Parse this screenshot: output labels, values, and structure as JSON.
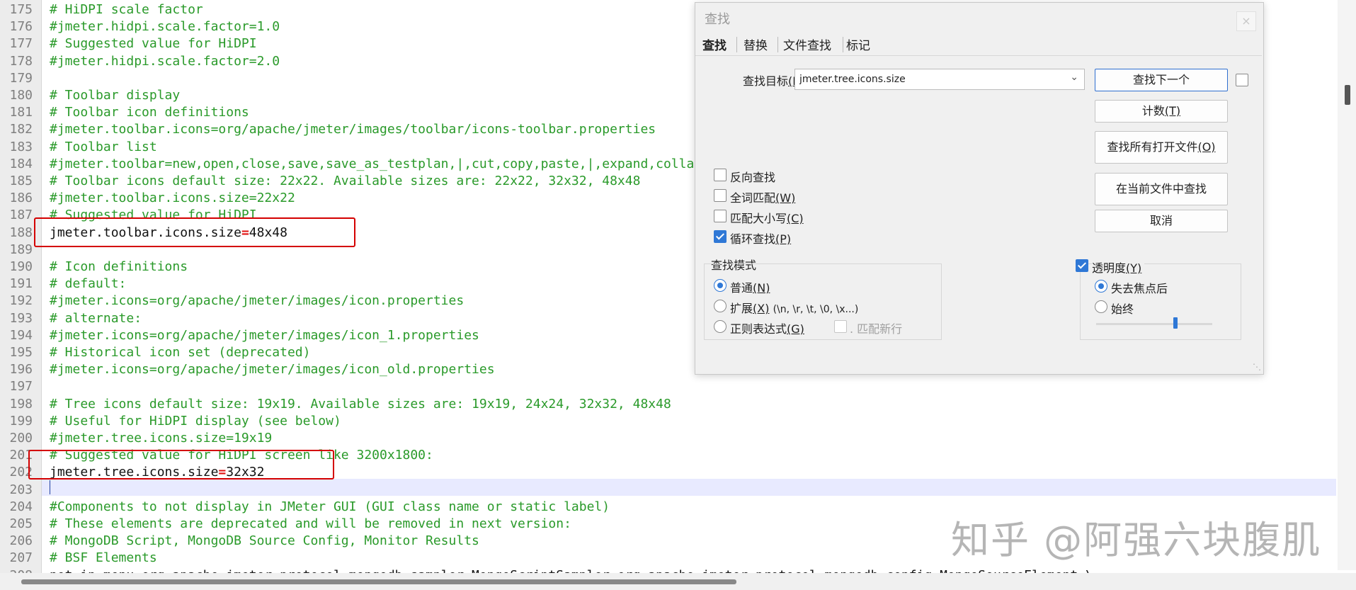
{
  "editor": {
    "lines": [
      {
        "n": "175",
        "text": "# HiDPI scale factor"
      },
      {
        "n": "176",
        "text": "#jmeter.hidpi.scale.factor=1.0"
      },
      {
        "n": "177",
        "text": "# Suggested value for HiDPI"
      },
      {
        "n": "178",
        "text": "#jmeter.hidpi.scale.factor=2.0"
      },
      {
        "n": "179",
        "text": ""
      },
      {
        "n": "180",
        "text": "# Toolbar display"
      },
      {
        "n": "181",
        "text": "# Toolbar icon definitions"
      },
      {
        "n": "182",
        "text": "#jmeter.toolbar.icons=org/apache/jmeter/images/toolbar/icons-toolbar.properties"
      },
      {
        "n": "183",
        "text": "# Toolbar list"
      },
      {
        "n": "184",
        "text": "#jmeter.toolbar=new,open,close,save,save_as_testplan,|,cut,copy,paste,|,expand,collapse,toggle,|,test_start,test_stop,test_shutdown,|,test_start_remote_"
      },
      {
        "n": "185",
        "text": "# Toolbar icons default size: 22x22. Available sizes are: 22x22, 32x32, 48x48"
      },
      {
        "n": "186",
        "text": "#jmeter.toolbar.icons.size=22x22"
      },
      {
        "n": "187",
        "text": "# Suggested value for HiDPI"
      },
      {
        "n": "188",
        "key": "jmeter.toolbar.icons.size",
        "op": "=",
        "value": "48x48"
      },
      {
        "n": "189",
        "text": ""
      },
      {
        "n": "190",
        "text": "# Icon definitions"
      },
      {
        "n": "191",
        "text": "# default:"
      },
      {
        "n": "192",
        "text": "#jmeter.icons=org/apache/jmeter/images/icon.properties"
      },
      {
        "n": "193",
        "text": "# alternate:"
      },
      {
        "n": "194",
        "text": "#jmeter.icons=org/apache/jmeter/images/icon_1.properties"
      },
      {
        "n": "195",
        "text": "# Historical icon set (deprecated)"
      },
      {
        "n": "196",
        "text": "#jmeter.icons=org/apache/jmeter/images/icon_old.properties"
      },
      {
        "n": "197",
        "text": ""
      },
      {
        "n": "198",
        "text": "# Tree icons default size: 19x19. Available sizes are: 19x19, 24x24, 32x32, 48x48"
      },
      {
        "n": "199",
        "text": "# Useful for HiDPI display (see below)"
      },
      {
        "n": "200",
        "text": "#jmeter.tree.icons.size=19x19"
      },
      {
        "n": "201",
        "text": "# Suggested value for HiDPI screen like 3200x1800:"
      },
      {
        "n": "202",
        "key": "jmeter.tree.icons.size",
        "op": "=",
        "value": "32x32"
      },
      {
        "n": "203",
        "text": ""
      },
      {
        "n": "204",
        "text": "#Components to not display in JMeter GUI (GUI class name or static label)"
      },
      {
        "n": "205",
        "text": "# These elements are deprecated and will be removed in next version:"
      },
      {
        "n": "206",
        "text": "# MongoDB Script, MongoDB Source Config, Monitor Results"
      },
      {
        "n": "207",
        "text": "# BSF Elements"
      },
      {
        "n": "208",
        "key": "not_in_menu",
        "op": "=",
        "value": "org.apache.jmeter.protocol.mongodb.sampler.MongoScriptSampler,org.apache.jmeter.protocol.mongodb.config.MongoSourceElement,\\"
      }
    ]
  },
  "dialog": {
    "title": "查找",
    "close_icon": "×",
    "tabs": [
      "查找",
      "替换",
      "文件查找",
      "标记"
    ],
    "find_label": "查找目标",
    "find_label_key": "(F)",
    "find_label_colon": " :",
    "find_value": "jmeter.tree.icons.size",
    "buttons": {
      "find_next": "查找下一个",
      "count": "计数",
      "count_key": "(T)",
      "find_all_open": "查找所有打开文件",
      "find_all_open_key": "(O)",
      "find_current": "在当前文件中查找",
      "cancel": "取消"
    },
    "options": [
      {
        "label": "反向查找",
        "key": "",
        "checked": false
      },
      {
        "label": "全词匹配",
        "key": "(W)",
        "checked": false
      },
      {
        "label": "匹配大小写",
        "key": "(C)",
        "checked": false
      },
      {
        "label": "循环查找",
        "key": "(P)",
        "checked": true
      }
    ],
    "search_mode": {
      "label": "查找模式",
      "normal": "普通",
      "normal_key": "(N)",
      "extended": "扩展",
      "extended_key": "(X)",
      "extended_hint": "(\\n, \\r, \\t, \\0, \\x...)",
      "regex": "正则表达式",
      "regex_key": "(G)",
      "newline_prefix": ". ",
      "newline": "匹配新行",
      "selected": "normal"
    },
    "transparency": {
      "label": "透明度",
      "key": "(Y)",
      "checked": true,
      "on_lose_focus": "失去焦点后",
      "always": "始终",
      "selected": "on_lose_focus",
      "level": 0.68
    }
  },
  "watermark": "知乎 @阿强六块腹肌"
}
